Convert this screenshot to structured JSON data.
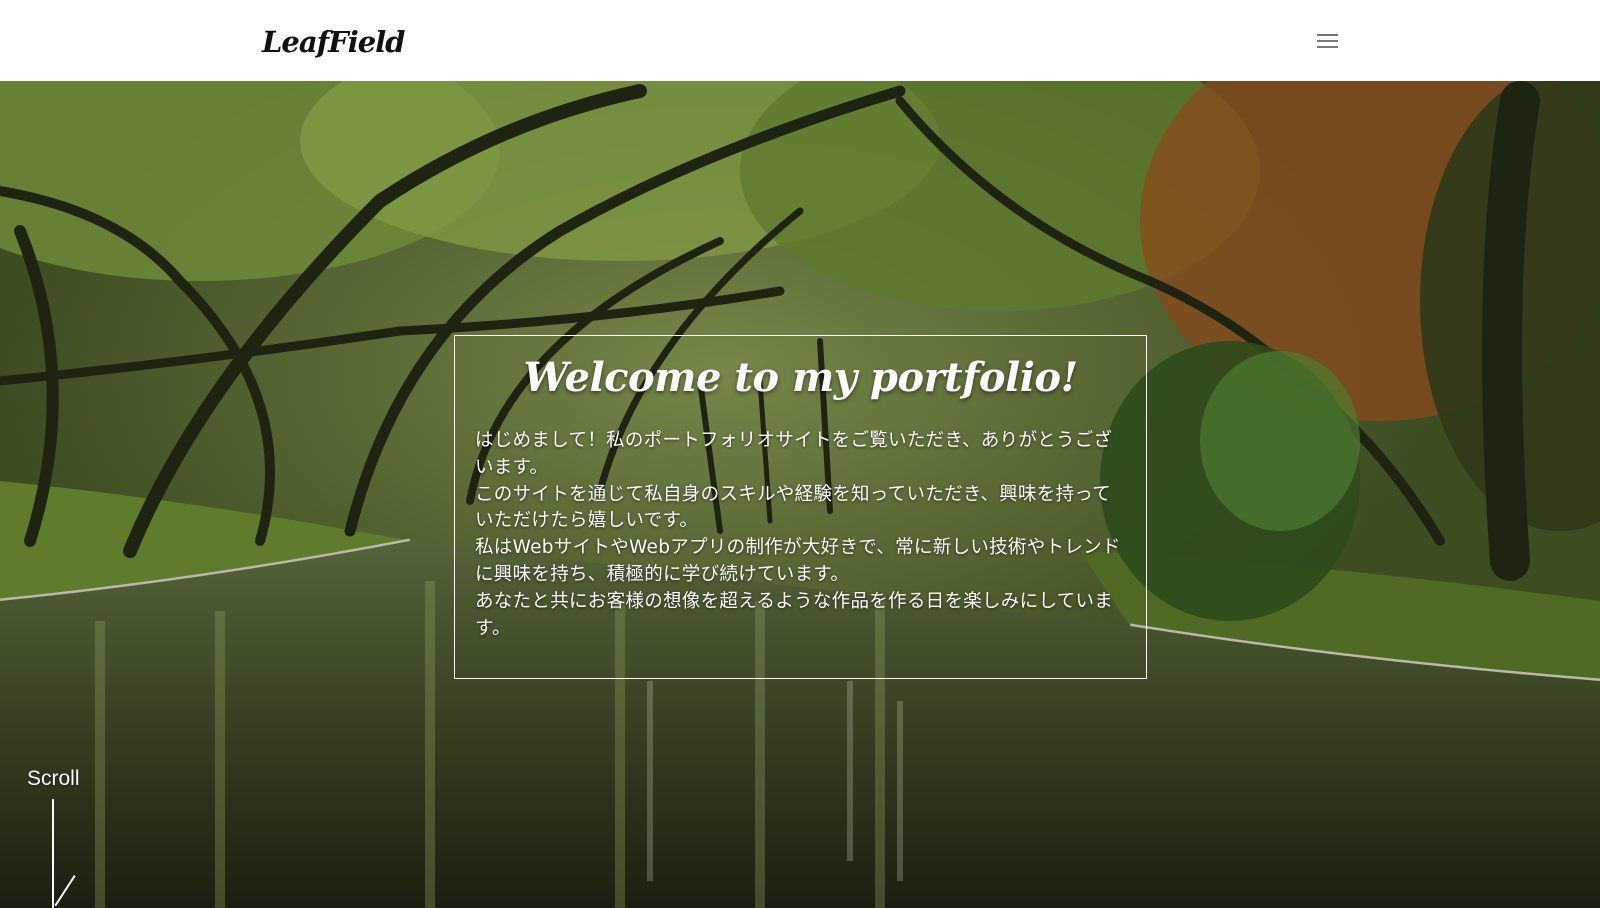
{
  "header": {
    "logo": "LeafField",
    "menu_icon": "hamburger-menu-icon"
  },
  "hero": {
    "title": "Welcome to my portfolio!",
    "paragraphs": [
      "はじめまして！私のポートフォリオサイトをご覧いただき、ありがとうございます。",
      "このサイトを通じて私自身のスキルや経験を知っていただき、興味を持っていただけたら嬉しいです。",
      "私はWebサイトやWebアプリの制作が大好きで、常に新しい技術やトレンドに興味を持ち、積極的に学び続けています。",
      "あなたと共にお客様の想像を超えるような作品を作る日を楽しみにしています。"
    ],
    "scroll_label": "Scroll"
  },
  "colors": {
    "header_bg": "#ffffff",
    "logo": "#111111",
    "menu_bars": "#777777",
    "overlay_text": "#ffffff",
    "foliage": "#6f8a3a",
    "autumn_foliage": "#8a4a1e",
    "water": "#2e3a1c"
  }
}
